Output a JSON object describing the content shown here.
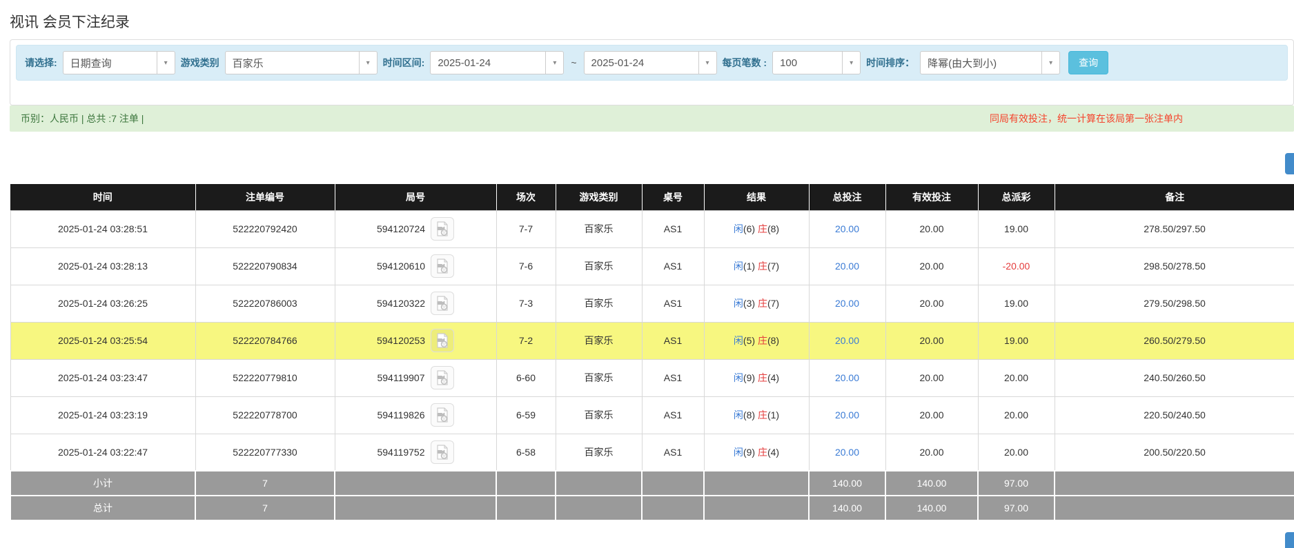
{
  "page": {
    "title": "视讯 会员下注纪录"
  },
  "filter": {
    "select_label": "请选择:",
    "select_value": "日期查询",
    "game_label": "游戏类别",
    "game_value": "百家乐",
    "range_label": "时间区间:",
    "date_from": "2025-01-24",
    "range_separator": "~",
    "date_to": "2025-01-24",
    "per_page_label": "每页笔数 :",
    "per_page_value": "100",
    "sort_label": "时间排序：",
    "sort_value": "降幂(由大到小)",
    "search_button": "查询"
  },
  "icons": {
    "caret_down": "▾",
    "video_replay": "video-reel-document"
  },
  "summary": {
    "currency_info": "币别：人民币 | 总共 :7 注单 |",
    "notice": "同局有效投注，统一计算在该局第一张注单内"
  },
  "colors": {
    "filter_bg": "#d9edf7",
    "accent_button": "#5bc0de",
    "summary_bg": "#dff0d8",
    "summary_text": "#3c763d",
    "notice_red": "#f5432c",
    "header_bg": "#1b1b1b",
    "highlight_row": "#f7f780",
    "footer_bg": "#9a9a9a",
    "link_blue": "#3a7bd5",
    "banker_red": "#e43b3b",
    "edge_button": "#428bca"
  },
  "table": {
    "headers": [
      "时间",
      "注单编号",
      "局号",
      "场次",
      "游戏类别",
      "桌号",
      "结果",
      "总投注",
      "有效投注",
      "总派彩",
      "备注"
    ],
    "rows": [
      {
        "time": "2025-01-24 03:28:51",
        "bet_id": "522220792420",
        "round_id": "594120724",
        "session": "7-7",
        "game": "百家乐",
        "table_no": "AS1",
        "player": "闲",
        "player_num": "(6)",
        "banker": "庄",
        "banker_num": "(8)",
        "total_bet": "20.00",
        "valid_bet": "20.00",
        "payout": "19.00",
        "note": "278.50/297.50",
        "highlight": false
      },
      {
        "time": "2025-01-24 03:28:13",
        "bet_id": "522220790834",
        "round_id": "594120610",
        "session": "7-6",
        "game": "百家乐",
        "table_no": "AS1",
        "player": "闲",
        "player_num": "(1)",
        "banker": "庄",
        "banker_num": "(7)",
        "total_bet": "20.00",
        "valid_bet": "20.00",
        "payout": "-20.00",
        "note": "298.50/278.50",
        "highlight": false
      },
      {
        "time": "2025-01-24 03:26:25",
        "bet_id": "522220786003",
        "round_id": "594120322",
        "session": "7-3",
        "game": "百家乐",
        "table_no": "AS1",
        "player": "闲",
        "player_num": "(3)",
        "banker": "庄",
        "banker_num": "(7)",
        "total_bet": "20.00",
        "valid_bet": "20.00",
        "payout": "19.00",
        "note": "279.50/298.50",
        "highlight": false
      },
      {
        "time": "2025-01-24 03:25:54",
        "bet_id": "522220784766",
        "round_id": "594120253",
        "session": "7-2",
        "game": "百家乐",
        "table_no": "AS1",
        "player": "闲",
        "player_num": "(5)",
        "banker": "庄",
        "banker_num": "(8)",
        "total_bet": "20.00",
        "valid_bet": "20.00",
        "payout": "19.00",
        "note": "260.50/279.50",
        "highlight": true
      },
      {
        "time": "2025-01-24 03:23:47",
        "bet_id": "522220779810",
        "round_id": "594119907",
        "session": "6-60",
        "game": "百家乐",
        "table_no": "AS1",
        "player": "闲",
        "player_num": "(9)",
        "banker": "庄",
        "banker_num": "(4)",
        "total_bet": "20.00",
        "valid_bet": "20.00",
        "payout": "20.00",
        "note": "240.50/260.50",
        "highlight": false
      },
      {
        "time": "2025-01-24 03:23:19",
        "bet_id": "522220778700",
        "round_id": "594119826",
        "session": "6-59",
        "game": "百家乐",
        "table_no": "AS1",
        "player": "闲",
        "player_num": "(8)",
        "banker": "庄",
        "banker_num": "(1)",
        "total_bet": "20.00",
        "valid_bet": "20.00",
        "payout": "20.00",
        "note": "220.50/240.50",
        "highlight": false
      },
      {
        "time": "2025-01-24 03:22:47",
        "bet_id": "522220777330",
        "round_id": "594119752",
        "session": "6-58",
        "game": "百家乐",
        "table_no": "AS1",
        "player": "闲",
        "player_num": "(9)",
        "banker": "庄",
        "banker_num": "(4)",
        "total_bet": "20.00",
        "valid_bet": "20.00",
        "payout": "20.00",
        "note": "200.50/220.50",
        "highlight": false
      }
    ],
    "footer": [
      {
        "label": "小计",
        "count": "7",
        "total_bet": "140.00",
        "valid_bet": "140.00",
        "payout": "97.00"
      },
      {
        "label": "总计",
        "count": "7",
        "total_bet": "140.00",
        "valid_bet": "140.00",
        "payout": "97.00"
      }
    ]
  }
}
